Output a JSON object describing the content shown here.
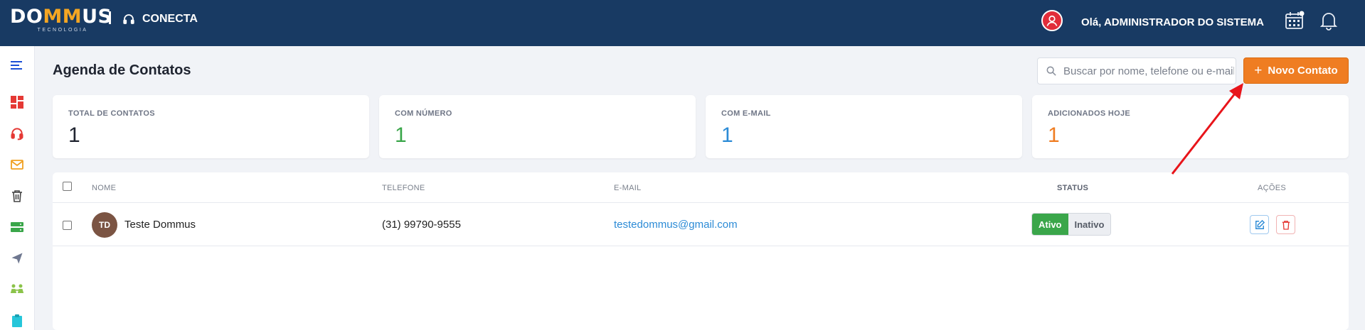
{
  "header": {
    "logo_left": "DO",
    "logo_mm": "MM",
    "logo_right": "US",
    "logo_sub": "TECNOLOGIA",
    "module": "CONECTA",
    "greeting": "Olá, ADMINISTRADOR DO SISTEMA"
  },
  "sidebar": {
    "items": [
      {
        "icon": "menu-icon",
        "color": "#1a4fd6"
      },
      {
        "icon": "dashboard-icon",
        "color": "#e53935"
      },
      {
        "icon": "headset-icon",
        "color": "#e53935"
      },
      {
        "icon": "mail-icon",
        "color": "#f0a020"
      },
      {
        "icon": "trash-icon",
        "color": "#444444"
      },
      {
        "icon": "server-icon",
        "color": "#3aa64a"
      },
      {
        "icon": "send-icon",
        "color": "#6f7890"
      },
      {
        "icon": "users-icon",
        "color": "#8bc34a"
      },
      {
        "icon": "clipboard-icon",
        "color": "#26c6da"
      }
    ]
  },
  "page": {
    "title": "Agenda de Contatos",
    "search_placeholder": "Buscar por nome, telefone ou e-mail",
    "new_button": "Novo Contato"
  },
  "cards": [
    {
      "label": "TOTAL DE CONTATOS",
      "value": "1",
      "color": "#1f2430"
    },
    {
      "label": "COM NÚMERO",
      "value": "1",
      "color": "#3aa64a"
    },
    {
      "label": "COM E-MAIL",
      "value": "1",
      "color": "#2c8bd6"
    },
    {
      "label": "ADICIONADOS HOJE",
      "value": "1",
      "color": "#ef7d22"
    }
  ],
  "table": {
    "columns": {
      "name": "NOME",
      "phone": "TELEFONE",
      "email": "E-MAIL",
      "status": "STATUS",
      "actions": "AÇÕES"
    },
    "rows": [
      {
        "initials": "TD",
        "name": "Teste Dommus",
        "phone": "(31) 99790-9555",
        "email": "testedommus@gmail.com",
        "status_active": "Ativo",
        "status_inactive": "Inativo"
      }
    ]
  },
  "colors": {
    "header_bg": "#183a63",
    "accent": "#ef7d22",
    "annotation_arrow": "#e8141a"
  }
}
